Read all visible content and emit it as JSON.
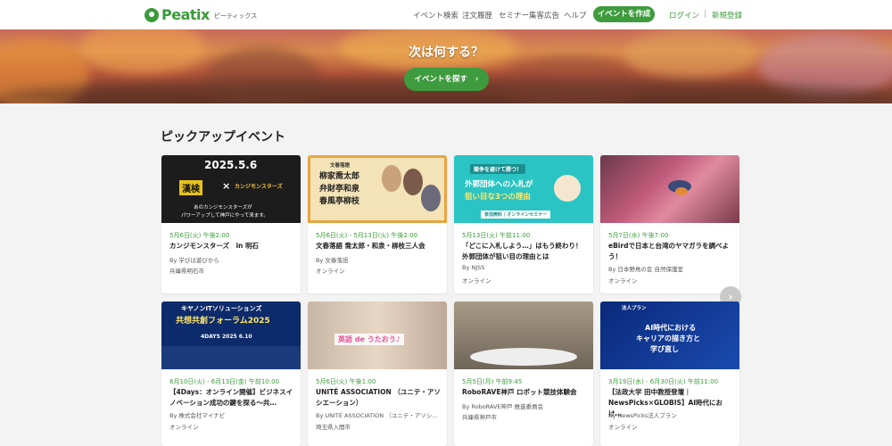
{
  "header": {
    "brand": "Peatix",
    "brand_sub": "ピーティックス",
    "nav": [
      "イベント検索",
      "注文履歴",
      "セミナー集客広告",
      "ヘルプ"
    ],
    "create_label": "イベントを作成",
    "login_label": "ログイン",
    "separator": "|",
    "signup_label": "新規登録"
  },
  "hero": {
    "title": "次は何する？",
    "button_label": "イベントを探す",
    "button_arrow": "›"
  },
  "section_title": "ピックアップイベント",
  "scroll_arrow": "›",
  "cards": [
    {
      "date": "5月6日(火) 午後2:00",
      "title": "カンジモンスターズ　in 明石",
      "org": "By 学びは遊びから",
      "loc": "兵庫県明石市",
      "img_text": [
        "2025.5.6",
        "漢検",
        "×",
        "カンジモンスターズ",
        "あのカンジモンスターズが",
        "パワーアップして神戸にやって来ます。"
      ]
    },
    {
      "date": "5月6日(火) - 5月13日(火) 午後2:00",
      "title": "文春落語 喬太郎・和泉・柳枝三人会",
      "org": "By 文春落語",
      "loc": "オンライン",
      "img_text": [
        "文春落語",
        "柳家喬太郎",
        "弁財亭和泉",
        "春風亭柳枝"
      ]
    },
    {
      "date": "5月13日(火) 午前11:00",
      "title": "「どこに入札しよう…」はもう終わり！外郭団体が狙い目の理由とは",
      "org": "By NJSS",
      "loc": "オンライン",
      "img_text": [
        "競争を避けて勝つ！",
        "外郭団体への入札が",
        "狙い目な3つの理由",
        "参加無料 / オンラインセミナー"
      ]
    },
    {
      "date": "5月7日(水) 午後7:00",
      "title": "eBirdで日本と台湾のヤマガラを調べよう！",
      "org": "By 日本野鳥の会 自然保護室",
      "loc": "オンライン",
      "img_text": []
    },
    {
      "date": "6月10日(火) - 6月13日(金) 午前10:00",
      "title": "【4Days：オンライン開催】ビジネスイノベーション成功の鍵を探る〜共…",
      "org": "By 株式会社マイナビ",
      "loc": "オンライン",
      "img_text": [
        "キヤノンITソリューションズ",
        "共想共創フォーラム2025",
        "4DAYS 2025 6.10"
      ]
    },
    {
      "date": "5月6日(火) 午後1:00",
      "title": "UNITÉ ASSOCIATION （ユニテ・アソシエーション）",
      "org": "By UNITÉ ASSOCIATION （ユニテ・アソシ…",
      "loc": "埼玉県入間市",
      "img_text": [
        "英語 de うたおう♪"
      ]
    },
    {
      "date": "5月5日(月) 午前9:45",
      "title": "RoboRAVE神戸 ロボット競技体験会",
      "org": "By RoboRAVE神戸 推進委員会",
      "loc": "兵庫県神戸市",
      "img_text": []
    },
    {
      "date": "3月19日(水) - 6月30日(火) 午前11:00",
      "title": "【法政大学 田中教授登壇｜NewsPicks×GLOBIS】AI時代におけ…",
      "org": "By NewsPicks法人プラン",
      "loc": "オンライン",
      "img_text": [
        "法人プラン",
        "AI時代における",
        "キャリアの描き方と",
        "学び直し"
      ]
    }
  ],
  "colors": {
    "brand_green": "#3e9b3e",
    "date_green": "#3a9a3a"
  }
}
